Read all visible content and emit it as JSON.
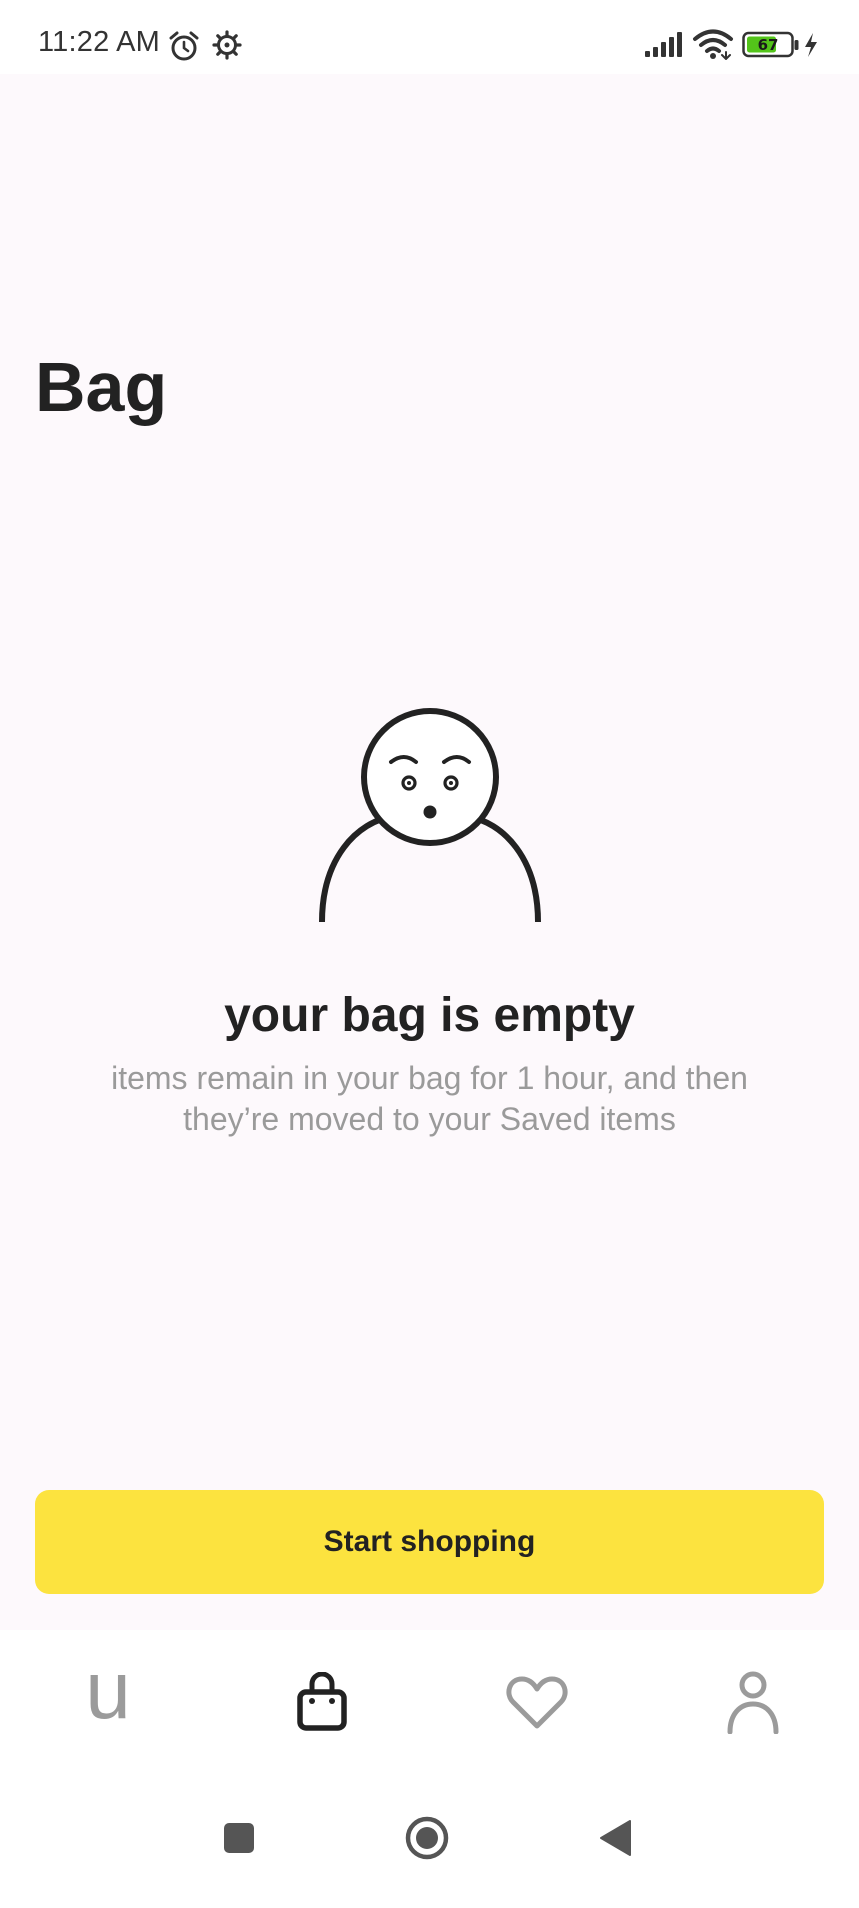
{
  "status_bar": {
    "time": "11:22 AM",
    "battery_level": "67",
    "icons": [
      "alarm-icon",
      "settings-icon",
      "signal-icon",
      "wifi-icon",
      "battery-icon",
      "charging-icon"
    ]
  },
  "page": {
    "title": "Bag"
  },
  "empty_state": {
    "illustration": "confused-person-illustration",
    "heading": "your bag is empty",
    "subtext": "items remain in your bag for 1 hour, and then they’re moved to your Saved items"
  },
  "actions": {
    "start_shopping_label": "Start shopping"
  },
  "tab_bar": {
    "active_tab": "bag",
    "tabs": [
      {
        "id": "home",
        "glyph": "u",
        "icon": "home-u-icon"
      },
      {
        "id": "bag",
        "icon": "shopping-bag-icon"
      },
      {
        "id": "saved",
        "icon": "heart-icon"
      },
      {
        "id": "account",
        "icon": "person-icon"
      }
    ]
  },
  "system_nav": {
    "buttons": [
      "recents-button",
      "home-button",
      "back-button"
    ]
  },
  "colors": {
    "primary_button": "#fce33f",
    "page_background": "#fdf9fc",
    "text_primary": "#222222",
    "text_secondary": "#9a9a9a",
    "tab_inactive": "#9b9b9b",
    "battery_fill": "#53c41a"
  }
}
